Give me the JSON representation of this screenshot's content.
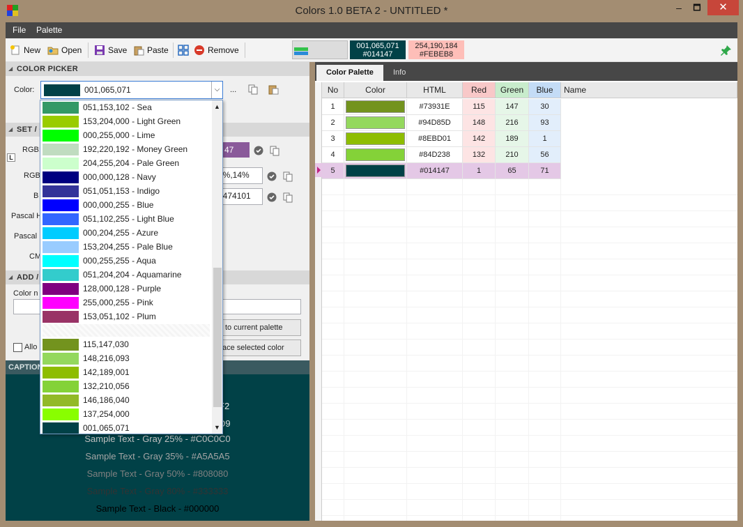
{
  "window": {
    "title": "Colors 1.0 BETA 2 - UNTITLED *",
    "close": "✕",
    "maximize": "🗖",
    "minimize": "–"
  },
  "menu": [
    "File",
    "Palette"
  ],
  "toolbar": {
    "new": "New",
    "open": "Open",
    "save": "Save",
    "paste": "Paste",
    "remove": "Remove"
  },
  "swatches": {
    "current": {
      "rgb": "001,065,071",
      "html": "#014147"
    },
    "complement": {
      "rgb": "254,190,184",
      "html": "#FEBEB8"
    }
  },
  "colorpicker": {
    "header": "COLOR PICKER",
    "color_label": "Color:",
    "value": "001,065,071",
    "ellipsis": "..."
  },
  "set_section": {
    "header": "SET / C",
    "rgb_label": "RGB:",
    "rgb_label2": "RGB",
    "b_label": "B",
    "pascal_h": "Pascal H",
    "pascal_l": "Pascal I",
    "cm_label": "CM",
    "rgb_tail": "47",
    "pct_tail": "7%,14%",
    "num_tail": "0474101",
    "l_badge": "L"
  },
  "add_section": {
    "header": "ADD /",
    "color_name_label": "Color n",
    "add_btn": "to current palette",
    "replace_btn": "ace selected color",
    "allow": "Allo"
  },
  "caption": {
    "header": "CAPTION",
    "samples": [
      {
        "text": "Sample Text - Gray 25% - #C0C0C0",
        "color": "#c0c0c0"
      },
      {
        "text": "Sample Text - Gray 35% - #A5A5A5",
        "color": "#a5a5a5"
      },
      {
        "text": "Sample Text - Gray 50% - #808080",
        "color": "#808080"
      },
      {
        "text": "Sample Text - Gray 80% - #333333",
        "color": "#333333"
      },
      {
        "text": "Sample Text - Black - #000000",
        "color": "#000000"
      }
    ],
    "partial1": "F2",
    "partial2": "D9"
  },
  "dropdown": {
    "named": [
      {
        "label": "051,153,102 - Sea",
        "color": "#339966"
      },
      {
        "label": "153,204,000 - Light Green",
        "color": "#99cc00"
      },
      {
        "label": "000,255,000 - Lime",
        "color": "#00ff00"
      },
      {
        "label": "192,220,192 - Money Green",
        "color": "#c0dcc0"
      },
      {
        "label": "204,255,204 - Pale Green",
        "color": "#ccffcc"
      },
      {
        "label": "000,000,128 - Navy",
        "color": "#000080"
      },
      {
        "label": "051,051,153 - Indigo",
        "color": "#333399"
      },
      {
        "label": "000,000,255 - Blue",
        "color": "#0000ff"
      },
      {
        "label": "051,102,255 - Light Blue",
        "color": "#3366ff"
      },
      {
        "label": "000,204,255 - Azure",
        "color": "#00ccff"
      },
      {
        "label": "153,204,255 - Pale Blue",
        "color": "#99ccff"
      },
      {
        "label": "000,255,255 - Aqua",
        "color": "#00ffff"
      },
      {
        "label": "051,204,204 - Aquamarine",
        "color": "#33cccc"
      },
      {
        "label": "128,000,128 - Purple",
        "color": "#800080"
      },
      {
        "label": "255,000,255 - Pink",
        "color": "#ff00ff"
      },
      {
        "label": "153,051,102 - Plum",
        "color": "#993366"
      }
    ],
    "recent": [
      {
        "label": "115,147,030",
        "color": "#73931e"
      },
      {
        "label": "148,216,093",
        "color": "#94d85d"
      },
      {
        "label": "142,189,001",
        "color": "#8ebd01"
      },
      {
        "label": "132,210,056",
        "color": "#84d238"
      },
      {
        "label": "146,186,040",
        "color": "#92ba28"
      },
      {
        "label": "137,254,000",
        "color": "#89fe00"
      },
      {
        "label": "001,065,071",
        "color": "#014147"
      }
    ]
  },
  "tabs": [
    "Color Palette",
    "Info"
  ],
  "grid": {
    "headers": [
      "No",
      "Color",
      "HTML",
      "Red",
      "Green",
      "Blue",
      "Name"
    ],
    "rows": [
      {
        "no": "1",
        "color": "#73931e",
        "html": "#73931E",
        "r": "115",
        "g": "147",
        "b": "30"
      },
      {
        "no": "2",
        "color": "#94d85d",
        "html": "#94D85D",
        "r": "148",
        "g": "216",
        "b": "93"
      },
      {
        "no": "3",
        "color": "#8ebd01",
        "html": "#8EBD01",
        "r": "142",
        "g": "189",
        "b": "1"
      },
      {
        "no": "4",
        "color": "#84d238",
        "html": "#84D238",
        "r": "132",
        "g": "210",
        "b": "56"
      },
      {
        "no": "5",
        "color": "#014147",
        "html": "#014147",
        "r": "1",
        "g": "65",
        "b": "71"
      }
    ]
  }
}
